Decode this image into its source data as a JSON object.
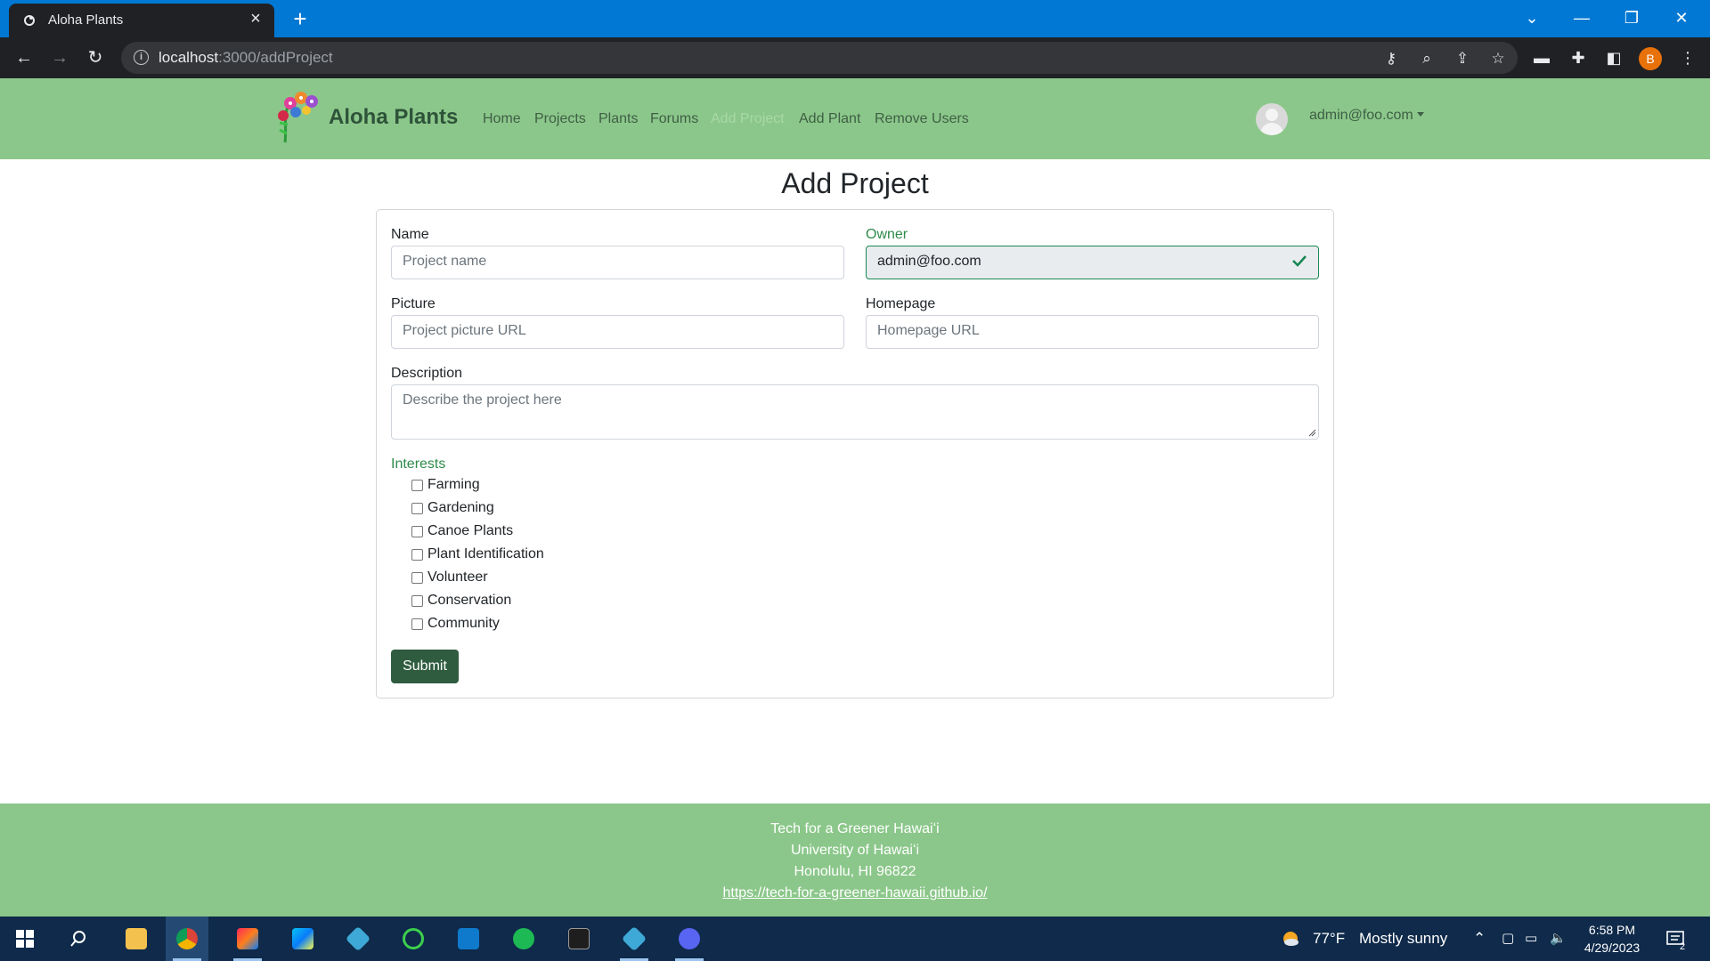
{
  "browser": {
    "tab_title": "Aloha Plants",
    "url_host": "localhost",
    "url_path": ":3000/addProject",
    "profile_initial": "B"
  },
  "site": {
    "brand": "Aloha Plants",
    "nav": [
      "Home",
      "Projects",
      "Plants",
      "Forums",
      "Add Project",
      "Add Plant",
      "Remove Users"
    ],
    "active_nav": "Add Project",
    "user": "admin@foo.com"
  },
  "form": {
    "title": "Add Project",
    "name_label": "Name",
    "name_placeholder": "Project name",
    "owner_label": "Owner",
    "owner_value": "admin@foo.com",
    "picture_label": "Picture",
    "picture_placeholder": "Project picture URL",
    "homepage_label": "Homepage",
    "homepage_placeholder": "Homepage URL",
    "description_label": "Description",
    "description_placeholder": "Describe the project here",
    "interests_label": "Interests",
    "interests": [
      "Farming",
      "Gardening",
      "Canoe Plants",
      "Plant Identification",
      "Volunteer",
      "Conservation",
      "Community"
    ],
    "submit_label": "Submit"
  },
  "footer": {
    "line1": "Tech for a Greener Hawaiʻi",
    "line2": "University of Hawaiʻi",
    "line3": "Honolulu, HI 96822",
    "link": "https://tech-for-a-greener-hawaii.github.io/"
  },
  "taskbar": {
    "weather_temp": "77°F",
    "weather_text": "Mostly sunny",
    "time": "6:58 PM",
    "date": "4/29/2023",
    "notifications": "2"
  },
  "colors": {
    "nav_green": "#8bc78a",
    "button_green": "#2f5c3f",
    "chrome_blue": "#0078d4"
  }
}
